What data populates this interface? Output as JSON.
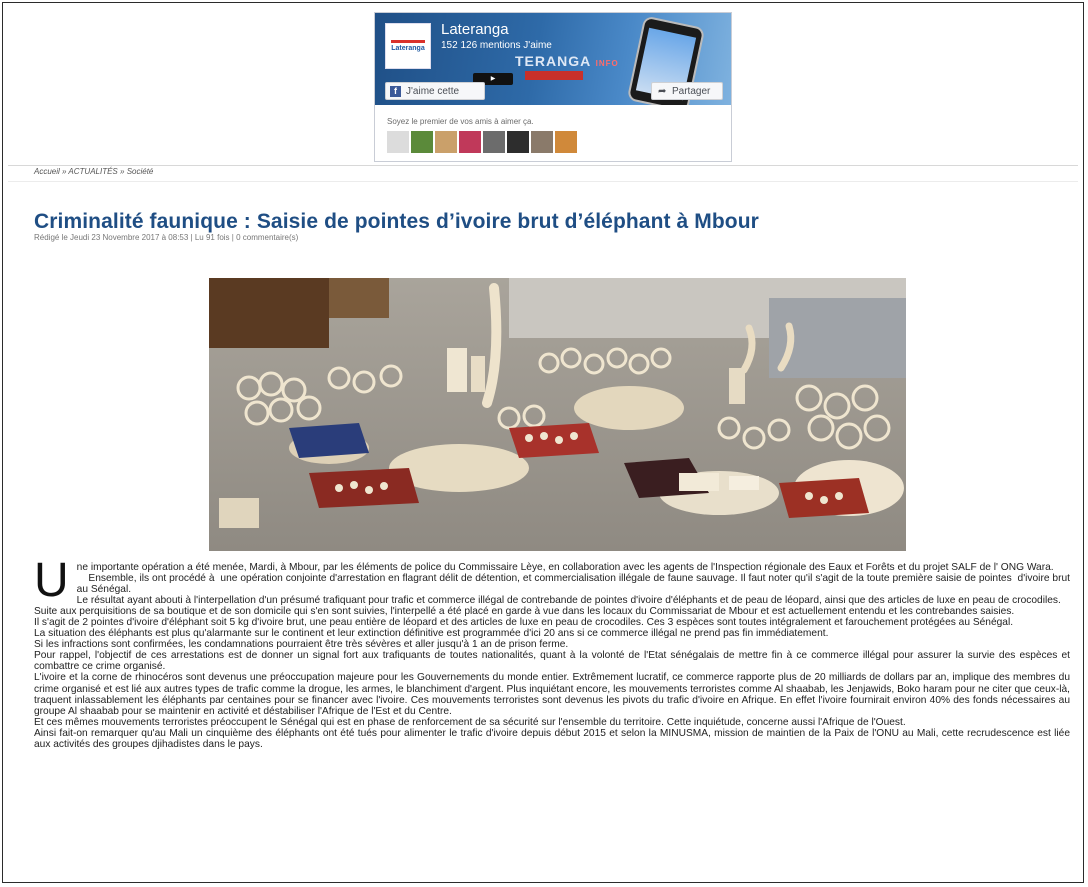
{
  "widget": {
    "page_name": "Lateranga",
    "likes": "152 126 mentions J'aime",
    "brand": "TERANGA",
    "brand_sub": "INFO",
    "like_label": "J'aime cette Page",
    "share_label": "Partager",
    "friends_text": "Soyez le premier de vos amis à aimer ça.",
    "avatars": [
      "#dcdcdc",
      "#5b8a3a",
      "#caa06a",
      "#c0395a",
      "#6c6c6c",
      "#2d2d2d",
      "#8a7a6a",
      "#d0893a"
    ],
    "colors": {
      "cover_dark": "#1f4f86",
      "cover_light": "#7fb2df",
      "fb_blue": "#3b5998"
    }
  },
  "breadcrumb": {
    "home": "Accueil",
    "sep1": "»",
    "section": "ACTUALITÉS",
    "sep2": "»",
    "category": "Société"
  },
  "article": {
    "title": "Criminalité faunique : Saisie de pointes d’ivoire brut d’éléphant à Mbour",
    "meta": "Rédigé le Jeudi 23 Novembre 2017 à 08:53 | Lu 91 fois | 0 commentaire(s)",
    "dropcap": "U",
    "p1": "ne importante opération a été menée, Mardi, à Mbour, par  les éléments de police du Commissaire Lèye, en collaboration avec les agents de l'Inspection régionale  des Eaux et Forêts et du projet  SALF de l' ONG Wara.",
    "p2": "    Ensemble, ils ont procédé à  une opération conjointe d'arrestation en flagrant délit de détention, et commercialisation illégale de faune sauvage. Il faut noter qu'il s'agit de la toute première saisie de pointes  d'ivoire brut au Sénégal.",
    "p3": "Le résultat ayant abouti à l'interpellation d'un  présumé trafiquant  pour trafic et commerce illégal  de contrebande de pointes d'ivoire d'éléphants et de peau de léopard, ainsi que des articles de luxe en peau de crocodiles.",
    "p4": " Suite aux perquisitions de sa boutique et  de son  domicile qui s'en sont suivies, l'interpellé a  été placé en garde à vue dans les locaux  du Commissariat de Mbour et est actuellement entendu et les contrebandes saisies.",
    "p5": "Il s'agit de 2 pointes  d'ivoire d'éléphant soit  5 kg d'ivoire brut,  une peau entière  de léopard et des articles de luxe en peau de crocodiles. Ces 3 espèces sont toutes intégralement et farouchement protégées au Sénégal.",
    "p6": " La situation des éléphants est plus qu'alarmante sur le continent et leur extinction définitive est programmée d'ici 20 ans si ce commerce illégal ne prend pas fin immédiatement.",
    "p7": "Si les infractions sont confirmées, les condamnations pourraient être très sévères et aller  jusqu'à 1 an de prison ferme.",
    "p8": "Pour rappel, l'objectif de ces arrestations est de donner un signal fort aux trafiquants de toutes nationalités, quant à la volonté de l'Etat sénégalais de mettre fin à ce commerce illégal pour assurer la survie des espèces et combattre ce crime organisé.",
    "p9": " L'ivoire et la corne de rhinocéros sont devenus une préoccupation majeure pour les Gouvernements du monde entier. Extrêmement lucratif, ce commerce rapporte plus de 20 milliards de dollars par an, implique des membres du crime organisé et est lié aux autres types de trafic comme la drogue, les armes, le blanchiment d'argent. Plus inquiétant encore, les mouvements terroristes comme Al shaabab, les Jenjawids, Boko haram pour ne citer que ceux-là, traquent inlassablement les éléphants par centaines pour se financer avec l'ivoire. Ces mouvements terroristes sont devenus les pivots du trafic d'ivoire en Afrique. En effet l'ivoire fournirait environ 40% des fonds nécessaires au groupe Al shaabab pour se maintenir en activité et déstabiliser l'Afrique de l'Est et du Centre.",
    "p10": " Et ces mêmes mouvements terroristes préoccupent le Sénégal qui est en phase de renforcement de sa sécurité sur l'ensemble du territoire. Cette inquiétude, concerne aussi l'Afrique de l'Ouest.",
    "p11": " Ainsi fait-on remarquer qu'au Mali un cinquième des éléphants ont été tués pour alimenter le trafic d'ivoire depuis début 2015 et selon la MINUSMA, mission de maintien de la Paix de l'ONU au Mali, cette recrudescence est liée aux activités des groupes djihadistes dans le pays."
  }
}
